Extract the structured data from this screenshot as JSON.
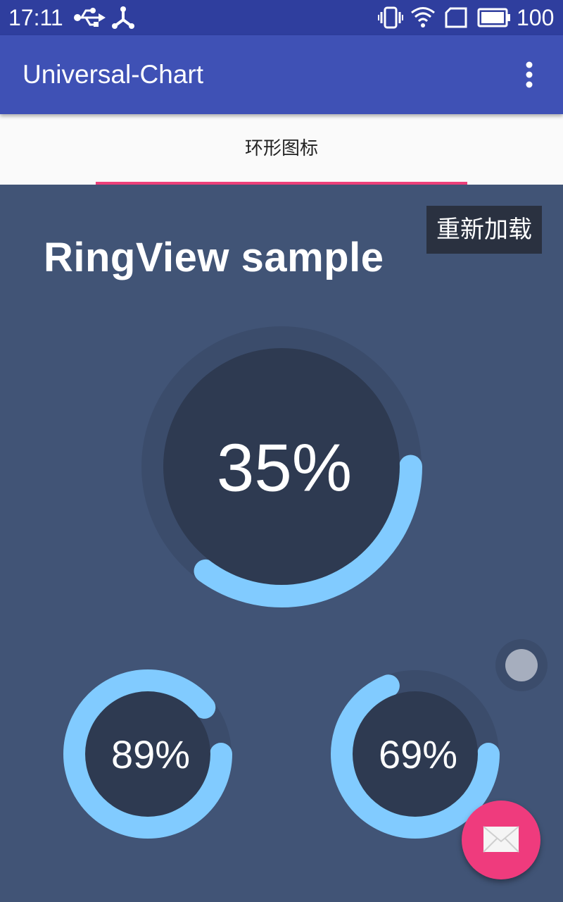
{
  "status_bar": {
    "time": "17:11",
    "battery_level": "100",
    "icons": [
      "usb-icon",
      "share-icon",
      "vibrate-icon",
      "wifi-icon",
      "sim-icon",
      "battery-icon"
    ]
  },
  "app_bar": {
    "title": "Universal-Chart",
    "menu_icon": "overflow-menu-icon"
  },
  "tabs": [
    {
      "label": "环形图标",
      "selected": true
    }
  ],
  "main": {
    "title": "RingView sample",
    "reload_label": "重新加载"
  },
  "rings": [
    {
      "label": "35%",
      "percent": 35
    },
    {
      "label": "89%",
      "percent": 89
    },
    {
      "label": "69%",
      "percent": 69
    }
  ],
  "fab": {
    "icon": "mail-icon"
  },
  "colors": {
    "status_bar": "#2f3e9e",
    "app_bar": "#3f51b5",
    "tab_indicator": "#ec407a",
    "background": "#415476",
    "ring_track": "#3b4c6b",
    "ring_inner": "#2e3a51",
    "ring_progress": "#81cbff",
    "fab": "#ef3b7d"
  }
}
